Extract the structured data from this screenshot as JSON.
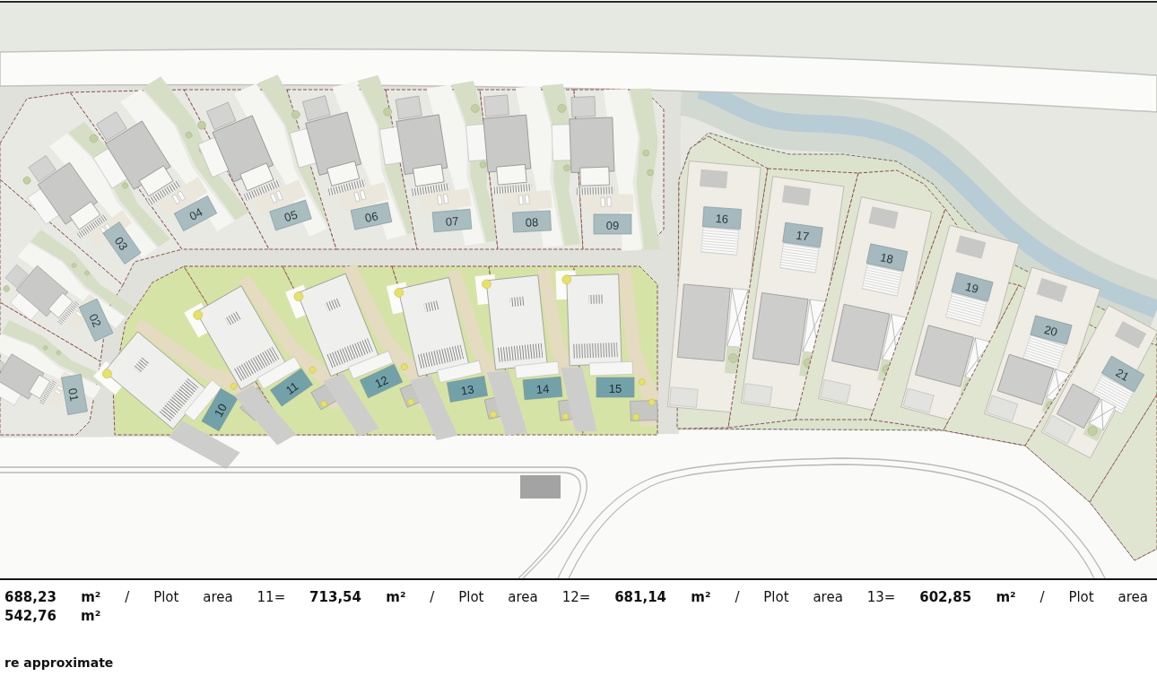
{
  "site_plan": {
    "plots": [
      {
        "label": "01",
        "kind": "hillside"
      },
      {
        "label": "02",
        "kind": "hillside"
      },
      {
        "label": "03",
        "kind": "hillside"
      },
      {
        "label": "04",
        "kind": "hillside"
      },
      {
        "label": "05",
        "kind": "hillside"
      },
      {
        "label": "06",
        "kind": "hillside"
      },
      {
        "label": "07",
        "kind": "hillside"
      },
      {
        "label": "08",
        "kind": "hillside"
      },
      {
        "label": "09",
        "kind": "hillside"
      },
      {
        "label": "10",
        "kind": "garden"
      },
      {
        "label": "11",
        "kind": "garden"
      },
      {
        "label": "12",
        "kind": "garden"
      },
      {
        "label": "13",
        "kind": "garden"
      },
      {
        "label": "14",
        "kind": "garden"
      },
      {
        "label": "15",
        "kind": "garden"
      },
      {
        "label": "16",
        "kind": "riverside"
      },
      {
        "label": "17",
        "kind": "riverside"
      },
      {
        "label": "18",
        "kind": "riverside"
      },
      {
        "label": "19",
        "kind": "riverside"
      },
      {
        "label": "20",
        "kind": "riverside"
      },
      {
        "label": "21",
        "kind": "riverside"
      }
    ]
  },
  "plot_areas": {
    "lines": [
      {
        "text": "**688,23 m²** / Plot area 11= **713,54 m²** / Plot area 12= **681,14 m²** / Plot area 13= **602,85 m²** / Plot area",
        "bold": false
      },
      {
        "text": "542,76 m²",
        "bold": true
      }
    ]
  },
  "note": "re approximate"
}
